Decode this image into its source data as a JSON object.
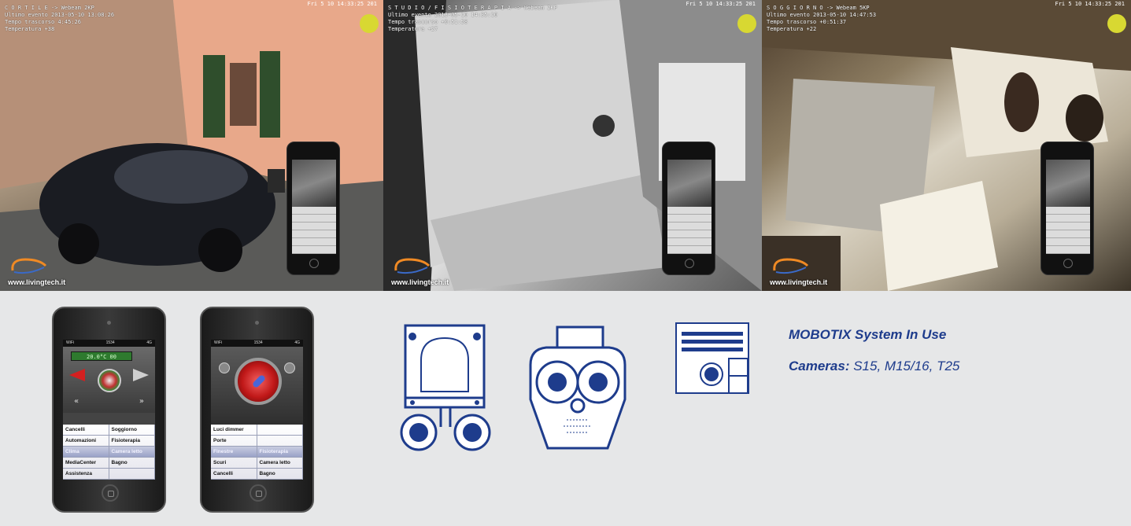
{
  "cameras": [
    {
      "osd": "C O R T I L E -> Webeam 2KP\nUltimo evento 2013-05-10 13:08:26\nTempo trascorso 4:45:26\nTemperatura +38",
      "topline": "Fri 5 10 14:33:25 201",
      "url": "www.livingtech.it"
    },
    {
      "osd": "S T U D I O / F I S I O T E R A P I A -> Webeam 2KP\nUltimo evento 2013-05-10 14:35:10\nTempo trascorso +0:51:58\nTemperatura +27",
      "topline": "Fri 5 10 14:33:25 201",
      "url": "www.livingtech.it"
    },
    {
      "osd": "S O G G I O R N O -> Webeam 5KP\nUltimo evento 2013-05-10 14:47:53\nTempo trascorso +0:51:37\nTemperatura +22",
      "topline": "Fri 5 10 14:33:25 201",
      "url": "www.livingtech.it"
    }
  ],
  "phone1": {
    "status_left": "WiFi",
    "status_center": "1534",
    "status_right": "4G",
    "display": "20.0°C 00",
    "menu": [
      {
        "label": "Cancelli",
        "hl": false
      },
      {
        "label": "Soggiorno",
        "hl": false
      },
      {
        "label": "Automazioni",
        "hl": false
      },
      {
        "label": "Fisioterapia",
        "hl": false
      },
      {
        "label": "Clima",
        "hl": true
      },
      {
        "label": "Camera letto",
        "hl": true
      },
      {
        "label": "MediaCenter",
        "hl": false
      },
      {
        "label": "Bagno",
        "hl": false
      },
      {
        "label": "Assistenza",
        "hl": false
      },
      {
        "label": "",
        "hl": false
      }
    ]
  },
  "phone2": {
    "status_left": "WiFi",
    "status_center": "1534",
    "status_right": "4G",
    "menu": [
      {
        "label": "Luci dimmer",
        "hl": false
      },
      {
        "label": "",
        "hl": false
      },
      {
        "label": "Porte",
        "hl": false
      },
      {
        "label": "",
        "hl": false
      },
      {
        "label": "Finestre",
        "hl": true
      },
      {
        "label": "Fisioterapia",
        "hl": true
      },
      {
        "label": "Scuri",
        "hl": false
      },
      {
        "label": "Camera letto",
        "hl": false
      },
      {
        "label": "Cancelli",
        "hl": false
      },
      {
        "label": "Bagno",
        "hl": false
      }
    ]
  },
  "caption": {
    "line1": "MOBOTIX System In Use",
    "line2_label": "Cameras:",
    "line2_value": " S15, M15/16, T25"
  },
  "colors": {
    "brand_blue": "#1e3c8c",
    "background": "#e6e7e8",
    "osd_dot": "#d8d832"
  },
  "icons": [
    "s15-camera-icon",
    "m15-camera-icon",
    "t25-door-station-icon"
  ]
}
